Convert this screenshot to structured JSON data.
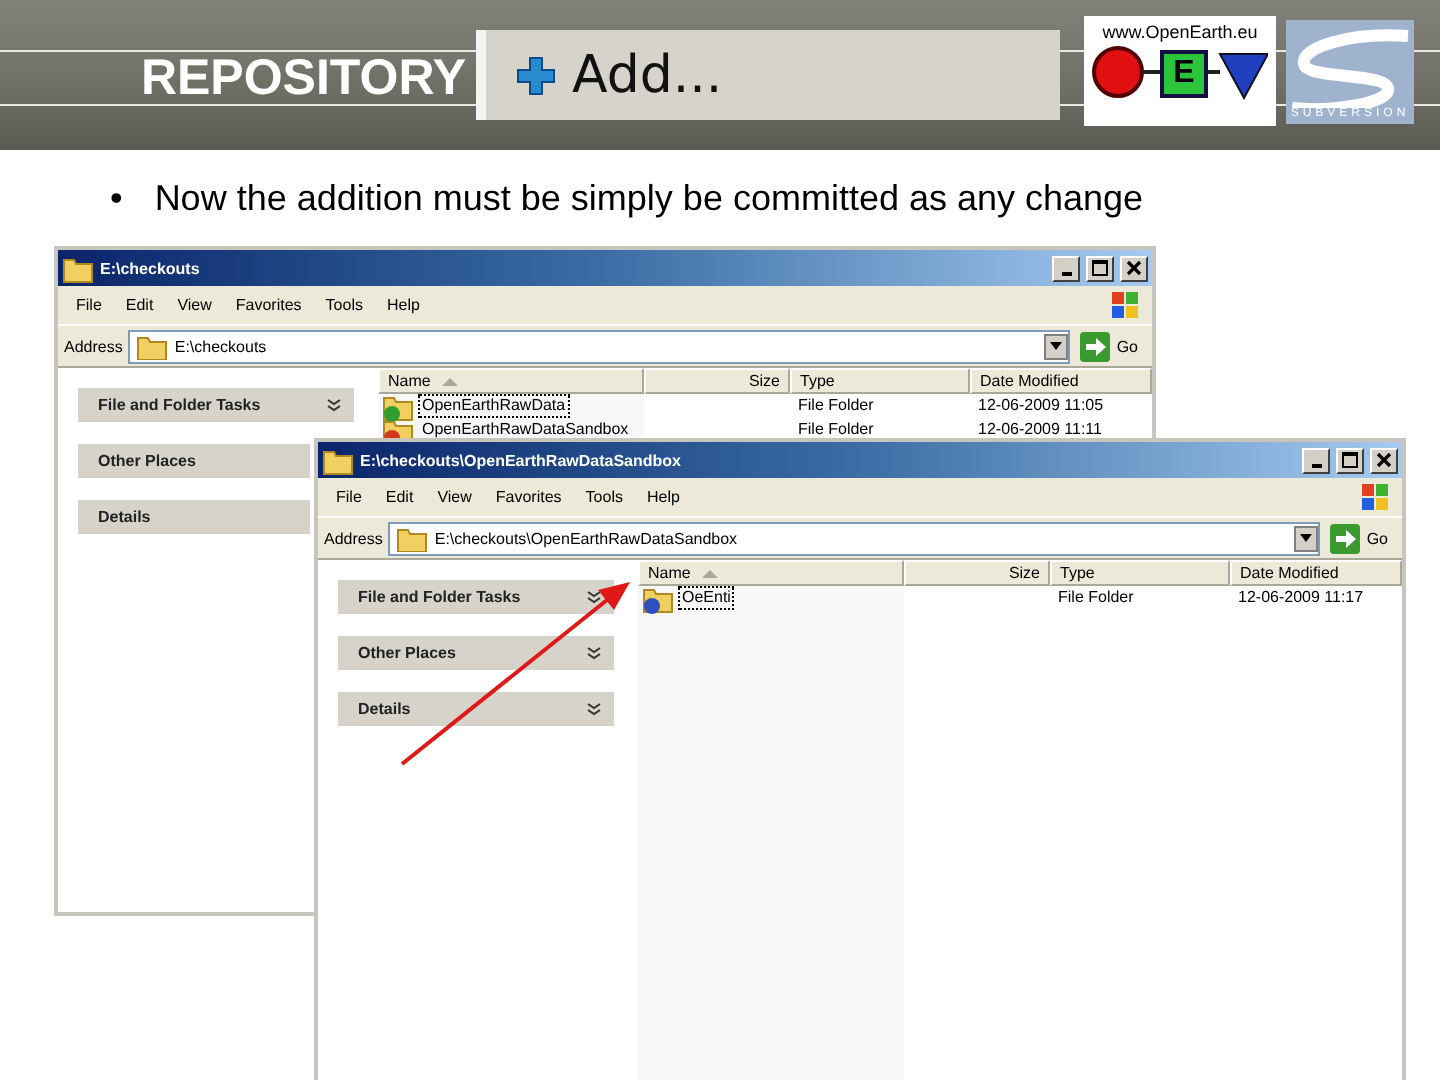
{
  "header": {
    "section": "REPOSITORY",
    "title": "Add..."
  },
  "logos": {
    "openearth_url": "www.OpenEarth.eu",
    "openearth_letter": "E",
    "subversion_text": "SUBVERSION"
  },
  "bullets": [
    {
      "mark": "•",
      "text": "Now the addition must be simply be committed as any change"
    }
  ],
  "windows": [
    {
      "title": "E:\\checkouts",
      "menu": [
        "File",
        "Edit",
        "View",
        "Favorites",
        "Tools",
        "Help"
      ],
      "address_label": "Address",
      "address": "E:\\checkouts",
      "go": "Go",
      "panels": [
        "File and Folder Tasks",
        "Other Places",
        "Details"
      ],
      "columns": [
        "Name",
        "Size",
        "Type",
        "Date Modified"
      ],
      "rows": [
        {
          "name": "OpenEarthRawData",
          "type": "File Folder",
          "modified": "12-06-2009 11:05",
          "selected": true,
          "color": "#2e9e2e"
        },
        {
          "name": "OpenEarthRawDataSandbox",
          "type": "File Folder",
          "modified": "12-06-2009 11:11",
          "selected": false,
          "color": "#d03a1a"
        }
      ]
    },
    {
      "title": "E:\\checkouts\\OpenEarthRawDataSandbox",
      "menu": [
        "File",
        "Edit",
        "View",
        "Favorites",
        "Tools",
        "Help"
      ],
      "address_label": "Address",
      "address": "E:\\checkouts\\OpenEarthRawDataSandbox",
      "go": "Go",
      "panels": [
        "File and Folder Tasks",
        "Other Places",
        "Details"
      ],
      "columns": [
        "Name",
        "Size",
        "Type",
        "Date Modified"
      ],
      "rows": [
        {
          "name": "OeEnti",
          "type": "File Folder",
          "modified": "12-06-2009 11:17",
          "selected": true,
          "color": "#3050c0"
        }
      ]
    }
  ]
}
